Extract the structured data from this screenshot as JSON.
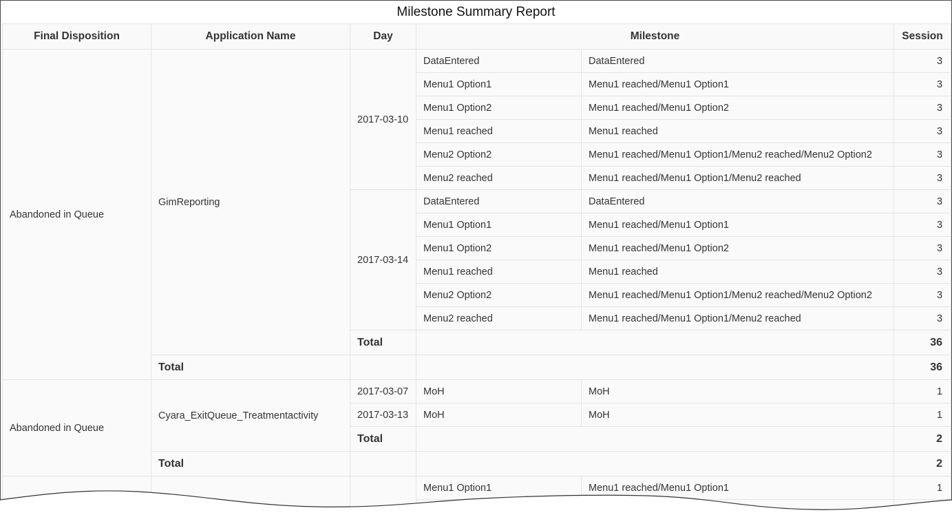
{
  "report": {
    "title": "Milestone Summary Report",
    "headers": {
      "final_disposition": "Final Disposition",
      "application_name": "Application Name",
      "day": "Day",
      "milestone": "Milestone",
      "session": "Session"
    },
    "groups": [
      {
        "disposition": "Abandoned in Queue",
        "application": "GimReporting",
        "days": [
          {
            "day": "2017-03-10",
            "rows": [
              {
                "milestone": "DataEntered",
                "path": "DataEntered",
                "session": "3"
              },
              {
                "milestone": "Menu1 Option1",
                "path": "Menu1 reached/Menu1 Option1",
                "session": "3"
              },
              {
                "milestone": "Menu1 Option2",
                "path": "Menu1 reached/Menu1 Option2",
                "session": "3"
              },
              {
                "milestone": "Menu1 reached",
                "path": "Menu1 reached",
                "session": "3"
              },
              {
                "milestone": "Menu2 Option2",
                "path": "Menu1 reached/Menu1 Option1/Menu2 reached/Menu2 Option2",
                "session": "3"
              },
              {
                "milestone": "Menu2 reached",
                "path": "Menu1 reached/Menu1 Option1/Menu2 reached",
                "session": "3"
              }
            ]
          },
          {
            "day": "2017-03-14",
            "rows": [
              {
                "milestone": "DataEntered",
                "path": "DataEntered",
                "session": "3"
              },
              {
                "milestone": "Menu1 Option1",
                "path": "Menu1 reached/Menu1 Option1",
                "session": "3"
              },
              {
                "milestone": "Menu1 Option2",
                "path": "Menu1 reached/Menu1 Option2",
                "session": "3"
              },
              {
                "milestone": "Menu1 reached",
                "path": "Menu1 reached",
                "session": "3"
              },
              {
                "milestone": "Menu2 Option2",
                "path": "Menu1 reached/Menu1 Option1/Menu2 reached/Menu2 Option2",
                "session": "3"
              },
              {
                "milestone": "Menu2 reached",
                "path": "Menu1 reached/Menu1 Option1/Menu2 reached",
                "session": "3"
              }
            ]
          }
        ],
        "day_total_label": "Total",
        "day_total": "36",
        "app_total_label": "Total",
        "app_total": "36"
      },
      {
        "disposition": "Abandoned in Queue",
        "application": "Cyara_ExitQueue_Treatmentactivity",
        "days": [
          {
            "day": "2017-03-07",
            "rows": [
              {
                "milestone": "MoH",
                "path": "MoH",
                "session": "1"
              }
            ]
          },
          {
            "day": "2017-03-13",
            "rows": [
              {
                "milestone": "MoH",
                "path": "MoH",
                "session": "1"
              }
            ]
          }
        ],
        "day_total_label": "Total",
        "day_total": "2",
        "app_total_label": "Total",
        "app_total": "2"
      }
    ],
    "partial_row": {
      "milestone": "Menu1 Option1",
      "path": "Menu1 reached/Menu1 Option1",
      "session": "1"
    }
  }
}
